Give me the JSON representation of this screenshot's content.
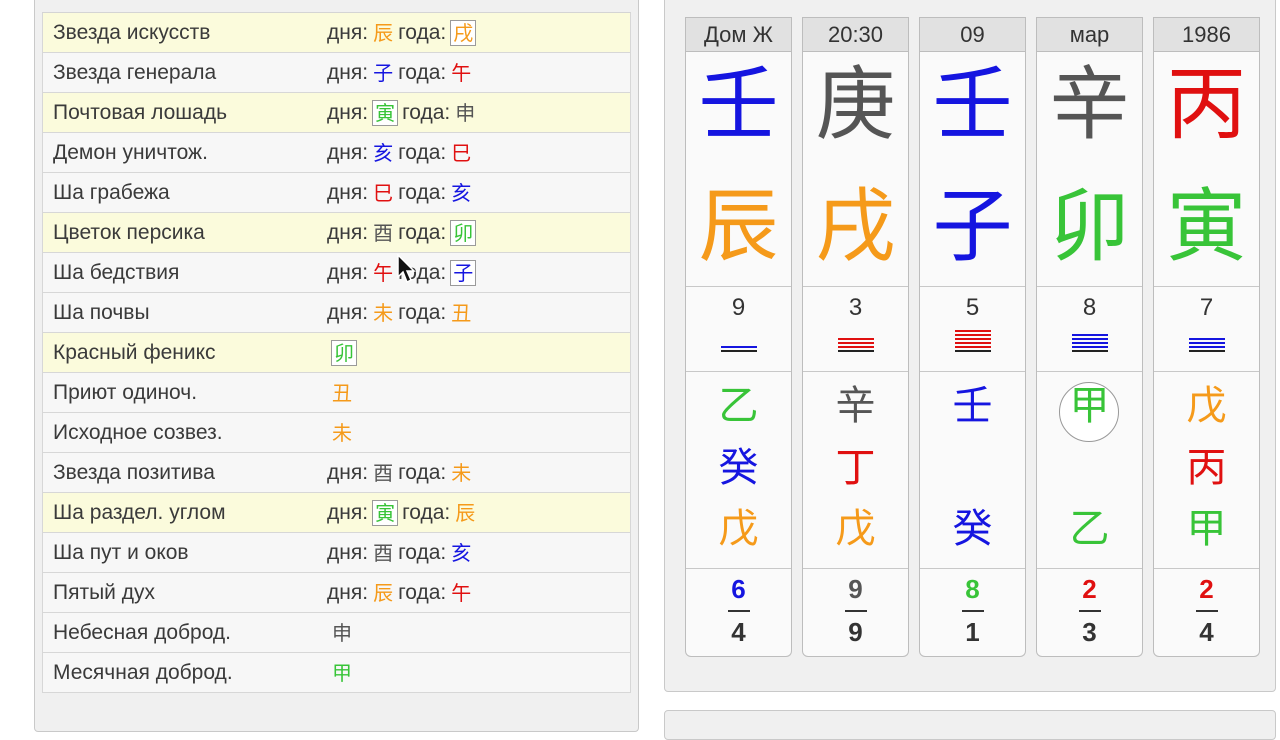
{
  "colors": {
    "orange": "#f59a1a",
    "blue": "#1515e0",
    "red": "#e01010",
    "green": "#38c438",
    "gray": "#555555",
    "dark": "#333333"
  },
  "stars": [
    {
      "name": "Звезда искусств",
      "hl": true,
      "day_label": "дня:",
      "day": {
        "ch": "辰",
        "color": "orange"
      },
      "year_label": "года:",
      "year": {
        "ch": "戌",
        "color": "orange",
        "boxed": true
      }
    },
    {
      "name": "Звезда генерала",
      "hl": false,
      "day_label": "дня:",
      "day": {
        "ch": "子",
        "color": "blue"
      },
      "year_label": "года:",
      "year": {
        "ch": "午",
        "color": "red"
      }
    },
    {
      "name": "Почтовая лошадь",
      "hl": true,
      "day_label": "дня:",
      "day": {
        "ch": "寅",
        "color": "green",
        "boxed": true
      },
      "year_label": "года:",
      "year": {
        "ch": "申",
        "color": "gray"
      }
    },
    {
      "name": "Демон уничтож.",
      "hl": false,
      "day_label": "дня:",
      "day": {
        "ch": "亥",
        "color": "blue"
      },
      "year_label": "года:",
      "year": {
        "ch": "巳",
        "color": "red"
      }
    },
    {
      "name": "Ша грабежа",
      "hl": false,
      "day_label": "дня:",
      "day": {
        "ch": "巳",
        "color": "red"
      },
      "year_label": "года:",
      "year": {
        "ch": "亥",
        "color": "blue"
      }
    },
    {
      "name": "Цветок персика",
      "hl": true,
      "day_label": "дня:",
      "day": {
        "ch": "酉",
        "color": "gray"
      },
      "year_label": "года:",
      "year": {
        "ch": "卯",
        "color": "green",
        "boxed": true
      }
    },
    {
      "name": "Ша бедствия",
      "hl": false,
      "day_label": "дня:",
      "day": {
        "ch": "午",
        "color": "red"
      },
      "year_label": "года:",
      "year": {
        "ch": "子",
        "color": "blue",
        "boxed": true
      }
    },
    {
      "name": "Ша почвы",
      "hl": false,
      "day_label": "дня:",
      "day": {
        "ch": "未",
        "color": "orange"
      },
      "year_label": "года:",
      "year": {
        "ch": "丑",
        "color": "orange"
      }
    },
    {
      "name": "Красный феникс",
      "hl": true,
      "single": {
        "ch": "卯",
        "color": "green",
        "boxed": true
      }
    },
    {
      "name": "Приют одиноч.",
      "hl": false,
      "single": {
        "ch": "丑",
        "color": "orange"
      }
    },
    {
      "name": "Исходное созвез.",
      "hl": false,
      "single": {
        "ch": "未",
        "color": "orange"
      }
    },
    {
      "name": "Звезда позитива",
      "hl": false,
      "day_label": "дня:",
      "day": {
        "ch": "酉",
        "color": "gray"
      },
      "year_label": "года:",
      "year": {
        "ch": "未",
        "color": "orange"
      }
    },
    {
      "name": "Ша раздел. углом",
      "hl": true,
      "day_label": "дня:",
      "day": {
        "ch": "寅",
        "color": "green",
        "boxed": true
      },
      "year_label": "года:",
      "year": {
        "ch": "辰",
        "color": "orange"
      }
    },
    {
      "name": "Ша пут и оков",
      "hl": false,
      "day_label": "дня:",
      "day": {
        "ch": "酉",
        "color": "gray"
      },
      "year_label": "года:",
      "year": {
        "ch": "亥",
        "color": "blue"
      }
    },
    {
      "name": "Пятый дух",
      "hl": false,
      "day_label": "дня:",
      "day": {
        "ch": "辰",
        "color": "orange"
      },
      "year_label": "года:",
      "year": {
        "ch": "午",
        "color": "red"
      }
    },
    {
      "name": "Небесная доброд.",
      "hl": false,
      "single": {
        "ch": "申",
        "color": "gray"
      }
    },
    {
      "name": "Месячная доброд.",
      "hl": false,
      "single": {
        "ch": "甲",
        "color": "green"
      }
    }
  ],
  "pillars": [
    {
      "header": "Дом Ж",
      "stem": {
        "ch": "壬",
        "color": "blue"
      },
      "branch": {
        "ch": "辰",
        "color": "orange"
      },
      "number": "9",
      "gua": {
        "color": "blue",
        "lines": 1
      },
      "hidden": [
        {
          "ch": "乙",
          "color": "green"
        },
        {
          "ch": "癸",
          "color": "blue"
        },
        {
          "ch": "戊",
          "color": "orange"
        }
      ],
      "frac_top": {
        "v": "6",
        "color": "blue"
      },
      "frac_bottom": "4"
    },
    {
      "header": "20:30",
      "stem": {
        "ch": "庚",
        "color": "gray"
      },
      "branch": {
        "ch": "戌",
        "color": "orange"
      },
      "number": "3",
      "gua": {
        "color": "red",
        "lines": 3
      },
      "hidden": [
        {
          "ch": "辛",
          "color": "gray"
        },
        {
          "ch": "丁",
          "color": "red"
        },
        {
          "ch": "戊",
          "color": "orange"
        }
      ],
      "frac_top": {
        "v": "9",
        "color": "gray"
      },
      "frac_bottom": "9"
    },
    {
      "header": "09",
      "stem": {
        "ch": "壬",
        "color": "blue"
      },
      "branch": {
        "ch": "子",
        "color": "blue"
      },
      "number": "5",
      "gua": {
        "color": "red",
        "lines": 5
      },
      "hidden": [
        {
          "ch": "壬",
          "color": "blue"
        },
        {
          "ch": "",
          "color": "blue"
        },
        {
          "ch": "癸",
          "color": "blue"
        }
      ],
      "frac_top": {
        "v": "8",
        "color": "green"
      },
      "frac_bottom": "1"
    },
    {
      "header": "мар",
      "stem": {
        "ch": "辛",
        "color": "gray"
      },
      "branch": {
        "ch": "卯",
        "color": "green"
      },
      "number": "8",
      "gua": {
        "color": "blue",
        "lines": 4
      },
      "hidden": [
        {
          "ch": "甲",
          "color": "green",
          "circled": true
        },
        {
          "ch": "",
          "color": "green"
        },
        {
          "ch": "乙",
          "color": "green"
        }
      ],
      "frac_top": {
        "v": "2",
        "color": "red"
      },
      "frac_bottom": "3"
    },
    {
      "header": "1986",
      "stem": {
        "ch": "丙",
        "color": "red"
      },
      "branch": {
        "ch": "寅",
        "color": "green"
      },
      "number": "7",
      "gua": {
        "color": "blue",
        "lines": 3
      },
      "hidden": [
        {
          "ch": "戊",
          "color": "orange"
        },
        {
          "ch": "丙",
          "color": "red"
        },
        {
          "ch": "甲",
          "color": "green"
        }
      ],
      "frac_top": {
        "v": "2",
        "color": "red"
      },
      "frac_bottom": "4"
    }
  ]
}
